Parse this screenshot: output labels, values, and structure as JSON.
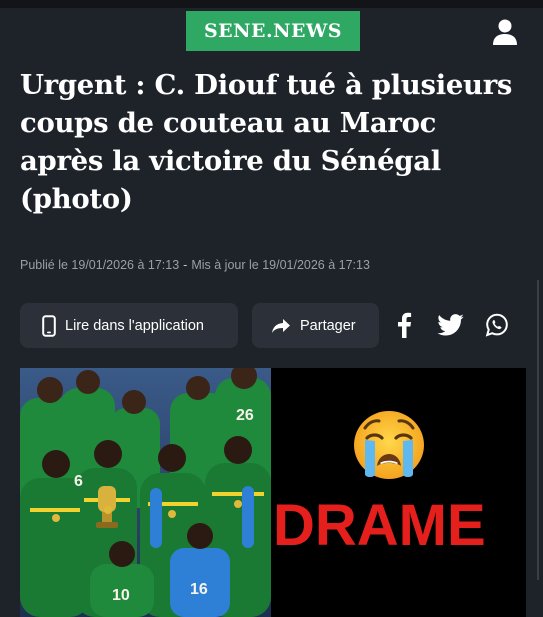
{
  "header": {
    "logo_text": "SENE.NEWS",
    "logo_color": "#2fa864",
    "user_icon": "user-icon"
  },
  "article": {
    "title": "Urgent : C. Diouf tué à plusieurs coups de couteau au Maroc après la victoire du Sénégal (photo)",
    "published": "Publié le 19/01/2026 à 17:13",
    "separator": "-",
    "updated": "Mis à jour le 19/01/2026 à 17:13"
  },
  "actions": {
    "app_label": "Lire dans l'application",
    "app_icon": "phone-icon",
    "share_label": "Partager",
    "share_icon": "share-arrow-icon",
    "social": [
      "facebook-icon",
      "twitter-icon",
      "whatsapp-icon"
    ]
  },
  "image": {
    "right_text": "DRAME",
    "accent_color": "#e5201c",
    "jersey_numbers": [
      "26",
      "10",
      "16",
      "6"
    ]
  }
}
